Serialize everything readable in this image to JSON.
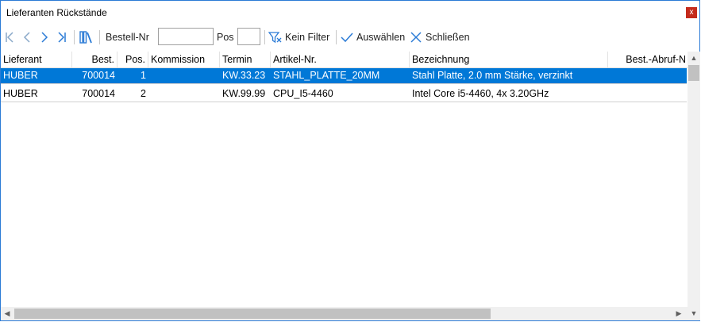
{
  "window": {
    "title": "Lieferanten Rückstände",
    "close_label": "x"
  },
  "toolbar": {
    "order_label": "Bestell-Nr",
    "order_value": "",
    "pos_label": "Pos",
    "pos_value": "",
    "filter_label": "Kein Filter",
    "select_label": "Auswählen",
    "close_label": "Schließen"
  },
  "columns": [
    "Lieferant",
    "Best.",
    "Pos.",
    "Kommission",
    "Termin",
    "Artikel-Nr.",
    "Bezeichnung",
    "Best.-Abruf-N"
  ],
  "rows": [
    {
      "lieferant": "HUBER",
      "best": "700014",
      "pos": "1",
      "kommission": "",
      "termin": "KW.33.23",
      "artikel": "STAHL_PLATTE_20MM",
      "bezeichnung": "Stahl Platte, 2.0 mm Stärke, verzinkt",
      "abruf": "",
      "selected": true
    },
    {
      "lieferant": "HUBER",
      "best": "700014",
      "pos": "2",
      "kommission": "",
      "termin": "KW.99.99",
      "artikel": "CPU_I5-4460",
      "bezeichnung": "Intel Core i5-4460, 4x 3.20GHz",
      "abruf": "",
      "selected": false
    }
  ],
  "colors": {
    "selection": "#0078d7",
    "close": "#c42b1c",
    "icon": "#2b7bd6"
  },
  "icons": [
    "first-icon",
    "prev-icon",
    "next-icon",
    "last-icon",
    "books-icon",
    "filter-off-icon",
    "check-icon",
    "x-icon"
  ]
}
